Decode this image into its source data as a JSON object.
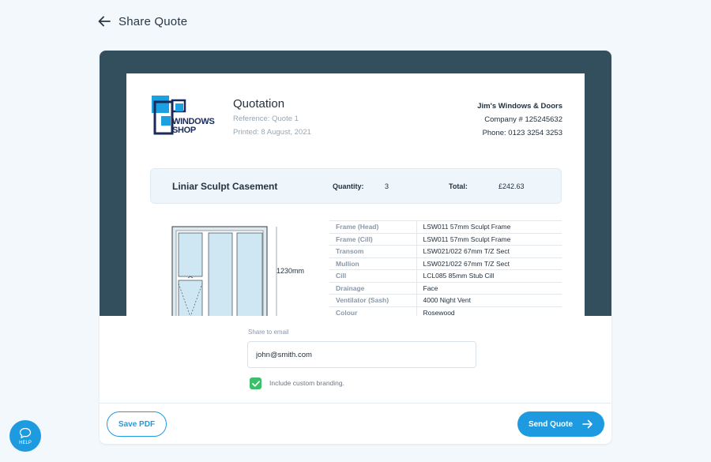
{
  "header": {
    "title": "Share Quote"
  },
  "quote": {
    "logo_text": [
      "WINDOWS",
      "SHOP"
    ],
    "title": "Quotation",
    "reference": "Reference: Quote 1",
    "printed": "Printed: 8 August, 2021",
    "company": {
      "name": "Jim's Windows & Doors",
      "number": "Company # 125245632",
      "phone": "Phone: 0123 3254 3253"
    },
    "product": {
      "name": "Liniar Sculpt Casement",
      "quantity_label": "Quantity:",
      "quantity": "3",
      "total_label": "Total:",
      "total": "£242.63"
    },
    "dimension": "1230mm",
    "specs": [
      {
        "key": "Frame (Head)",
        "value": "LSW011 57mm Sculpt Frame"
      },
      {
        "key": "Frame (Cill)",
        "value": "LSW011 57mm Sculpt Frame"
      },
      {
        "key": "Transom",
        "value": "LSW021/022 67mm T/Z Sect"
      },
      {
        "key": "Mullion",
        "value": "LSW021/022 67mm T/Z Sect"
      },
      {
        "key": "Cill",
        "value": "LCL085 85mm Stub Cill"
      },
      {
        "key": "Drainage",
        "value": "Face"
      },
      {
        "key": "Ventilator (Sash)",
        "value": "4000 Night Vent"
      },
      {
        "key": "Colour",
        "value": "Rosewood"
      }
    ]
  },
  "form": {
    "share_label": "Share to email",
    "email_value": "john@smith.com",
    "branding_label": "Include custom branding.",
    "branding_checked": true
  },
  "actions": {
    "save_pdf": "Save PDF",
    "send_quote": "Send Quote"
  },
  "help": {
    "label": "HELP"
  },
  "colors": {
    "accent": "#1e9be0",
    "preview_bg": "#334f5e",
    "check": "#3cbf6a",
    "page_bg": "#f2f8fc"
  }
}
